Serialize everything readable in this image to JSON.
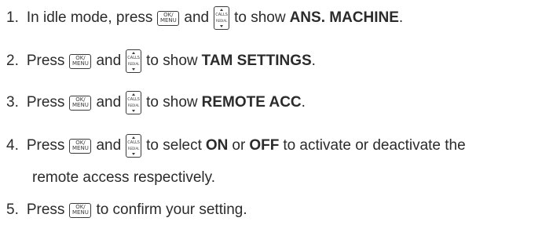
{
  "keys": {
    "ok_menu": [
      "OK/",
      "MENU"
    ],
    "calls": "CALLS",
    "redial": "REDIAL"
  },
  "steps": [
    {
      "num": "1.",
      "a": "In idle mode, press",
      "and": "and",
      "to": "to show",
      "bold": "ANS. MACHINE",
      "end": "."
    },
    {
      "num": "2.",
      "a": "Press",
      "and": "and",
      "to": "to show",
      "bold": "TAM SETTINGS",
      "end": "."
    },
    {
      "num": "3.",
      "a": "Press",
      "and": "and",
      "to": "to show",
      "bold": "REMOTE ACC",
      "end": "."
    },
    {
      "num": "4.",
      "a": "Press",
      "and": "and",
      "to": "to select",
      "bold": "ON",
      "or": "or",
      "bold2": "OFF",
      "rest": "to activate or deactivate the",
      "line2": "remote access respectively."
    },
    {
      "num": "5.",
      "a": "Press",
      "to": "to confirm your setting."
    }
  ]
}
